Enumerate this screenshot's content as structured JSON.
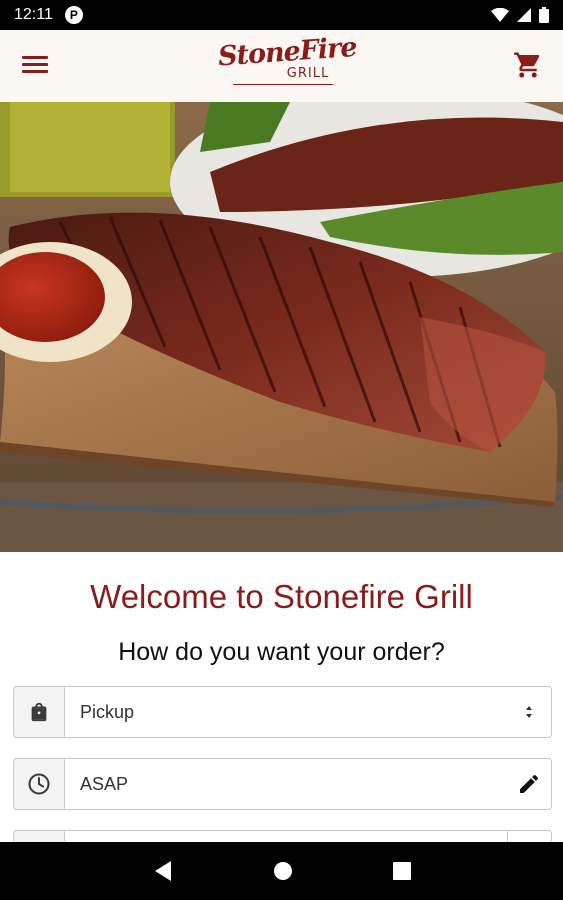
{
  "status_bar": {
    "time": "12:11",
    "notification_icon": "app-notification-icon",
    "icons": [
      "wifi-icon",
      "signal-icon",
      "battery-icon"
    ]
  },
  "header": {
    "logo_main": "StoneFire",
    "logo_sub": "GRILL",
    "menu_icon": "hamburger-menu-icon",
    "cart_icon": "shopping-cart-icon"
  },
  "hero": {
    "image_subject": "grilled-tri-tip-steak-image"
  },
  "main": {
    "welcome_title": "Welcome to Stonefire Grill",
    "question": "How do you want your order?",
    "order_type": {
      "icon": "shopping-bag-icon",
      "value": "Pickup",
      "action_icon": "select-arrows-icon"
    },
    "order_time": {
      "icon": "clock-icon",
      "value": "ASAP",
      "action_icon": "edit-pencil-icon"
    }
  },
  "colors": {
    "brand": "#8a1c1c",
    "header_bg": "#fbf8f4"
  }
}
